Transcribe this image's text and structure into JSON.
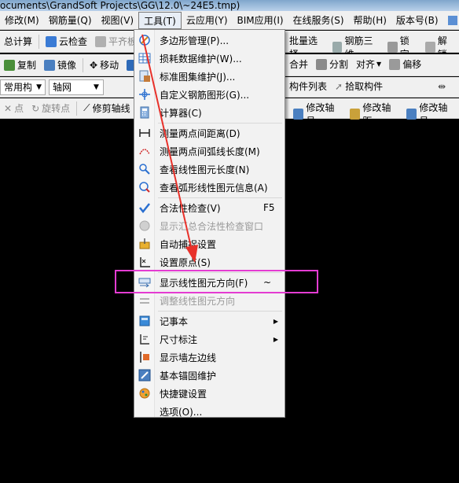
{
  "window": {
    "title": "ocuments\\GrandSoft Projects\\GG\\12.0\\~24E5.tmp)"
  },
  "menubar": {
    "items": [
      "修改(M)",
      "钢筋量(Q)",
      "视图(V)",
      "工具(T)",
      "云应用(Y)",
      "BIM应用(I)",
      "在线服务(S)",
      "帮助(H)",
      "版本号(B)",
      "新建"
    ]
  },
  "toolbar1": {
    "items": [
      "总计算",
      "云检查",
      "平齐板顶",
      "批量选择",
      "钢筋三维",
      "锁定",
      "解锁"
    ]
  },
  "toolbar2": {
    "items": [
      "复制",
      "镜像",
      "移动",
      "合并",
      "分割",
      "对齐",
      "偏移"
    ]
  },
  "toolbar3": {
    "combo1": "常用构件类",
    "combo2": "轴网",
    "items": [
      "构件列表",
      "拾取构件"
    ]
  },
  "toolbar4": {
    "items": [
      "点",
      "旋转点",
      "修剪轴线",
      "修改轴号",
      "修改轴距",
      "修改轴号"
    ]
  },
  "tools_menu": {
    "items": [
      {
        "label": "多边形管理(P)...",
        "icon": "polygon-icon"
      },
      {
        "label": "损耗数据维护(W)...",
        "icon": "table-icon"
      },
      {
        "label": "标准图集维护(J)...",
        "icon": "atlas-icon"
      },
      {
        "label": "自定义钢筋图形(G)...",
        "icon": "rebar-shape-icon"
      },
      {
        "label": "计算器(C)",
        "icon": "calculator-icon"
      },
      {
        "label": "测量两点间距离(D)",
        "icon": "measure-distance-icon"
      },
      {
        "label": "测量两点间弧线长度(M)",
        "icon": "measure-arc-icon"
      },
      {
        "label": "查看线性图元长度(N)",
        "icon": "line-length-icon"
      },
      {
        "label": "查看弧形线性图元信息(A)",
        "icon": "arc-info-icon"
      },
      {
        "label": "合法性检查(V)",
        "icon": "check-icon",
        "shortcut": "F5"
      },
      {
        "label": "显示汇总合法性检查窗口",
        "icon": "window-icon",
        "disabled": true
      },
      {
        "label": "自动捕捉设置",
        "icon": "snap-icon"
      },
      {
        "label": "设置原点(S)",
        "icon": "origin-icon"
      },
      {
        "label": "显示线性图元方向(F)",
        "icon": "direction-icon",
        "shortcut": "~"
      },
      {
        "label": "调整线性图元方向",
        "icon": "adjust-direction-icon",
        "disabled": true
      },
      {
        "label": "记事本",
        "icon": "notepad-icon",
        "submenu": true
      },
      {
        "label": "尺寸标注",
        "icon": "dimension-icon",
        "submenu": true
      },
      {
        "label": "显示墙左边线",
        "icon": "wall-left-icon"
      },
      {
        "label": "基本锚固维护",
        "icon": "anchor-icon"
      },
      {
        "label": "快捷键设置",
        "icon": "shortcut-icon"
      },
      {
        "label": "选项(O)...",
        "icon": "options-icon"
      }
    ]
  },
  "annotation": {
    "highlight_color": "#e43cd2",
    "arrow_color": "#e8312a"
  }
}
